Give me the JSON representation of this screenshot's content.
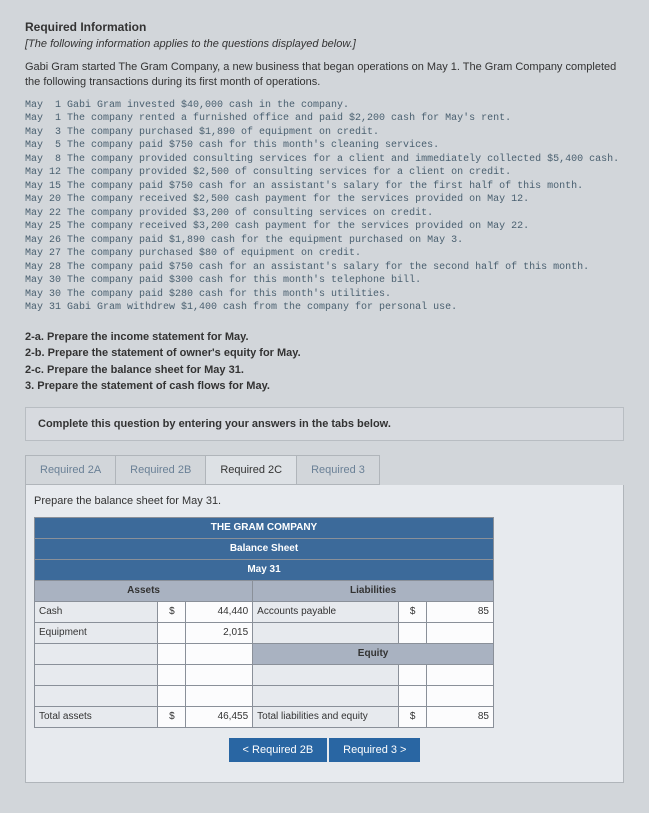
{
  "header": {
    "title": "Required Information",
    "subtitle": "[The following information applies to the questions displayed below.]",
    "narrative": "Gabi Gram started The Gram Company, a new business that began operations on May 1. The Gram Company completed the following transactions during its first month of operations."
  },
  "transactions": "May  1 Gabi Gram invested $40,000 cash in the company.\nMay  1 The company rented a furnished office and paid $2,200 cash for May's rent.\nMay  3 The company purchased $1,890 of equipment on credit.\nMay  5 The company paid $750 cash for this month's cleaning services.\nMay  8 The company provided consulting services for a client and immediately collected $5,400 cash.\nMay 12 The company provided $2,500 of consulting services for a client on credit.\nMay 15 The company paid $750 cash for an assistant's salary for the first half of this month.\nMay 20 The company received $2,500 cash payment for the services provided on May 12.\nMay 22 The company provided $3,200 of consulting services on credit.\nMay 25 The company received $3,200 cash payment for the services provided on May 22.\nMay 26 The company paid $1,890 cash for the equipment purchased on May 3.\nMay 27 The company purchased $80 of equipment on credit.\nMay 28 The company paid $750 cash for an assistant's salary for the second half of this month.\nMay 30 The company paid $300 cash for this month's telephone bill.\nMay 30 The company paid $280 cash for this month's utilities.\nMay 31 Gabi Gram withdrew $1,400 cash from the company for personal use.",
  "prepare": {
    "a": "2-a. Prepare the income statement for May.",
    "b": "2-b. Prepare the statement of owner's equity for May.",
    "c": "2-c. Prepare the balance sheet for May 31.",
    "d": "3. Prepare the statement of cash flows for May."
  },
  "banner": "Complete this question by entering your answers in the tabs below.",
  "tabs": {
    "t2a": "Required 2A",
    "t2b": "Required 2B",
    "t2c": "Required 2C",
    "t3": "Required 3"
  },
  "instruction": "Prepare the balance sheet for May 31.",
  "sheet": {
    "company": "THE GRAM COMPANY",
    "title": "Balance Sheet",
    "date": "May 31",
    "assets_hdr": "Assets",
    "liab_hdr": "Liabilities",
    "equity_hdr": "Equity",
    "rows": {
      "cash_label": "Cash",
      "cash_val": "44,440",
      "equip_label": "Equipment",
      "equip_val": "2,015",
      "ap_label": "Accounts payable",
      "ap_val": "85",
      "total_assets_label": "Total assets",
      "total_assets_val": "46,455",
      "total_le_label": "Total liabilities and equity",
      "total_le_val": "85"
    },
    "dollar": "$"
  },
  "nav": {
    "prev": "<  Required 2B",
    "next": "Required 3  >"
  }
}
